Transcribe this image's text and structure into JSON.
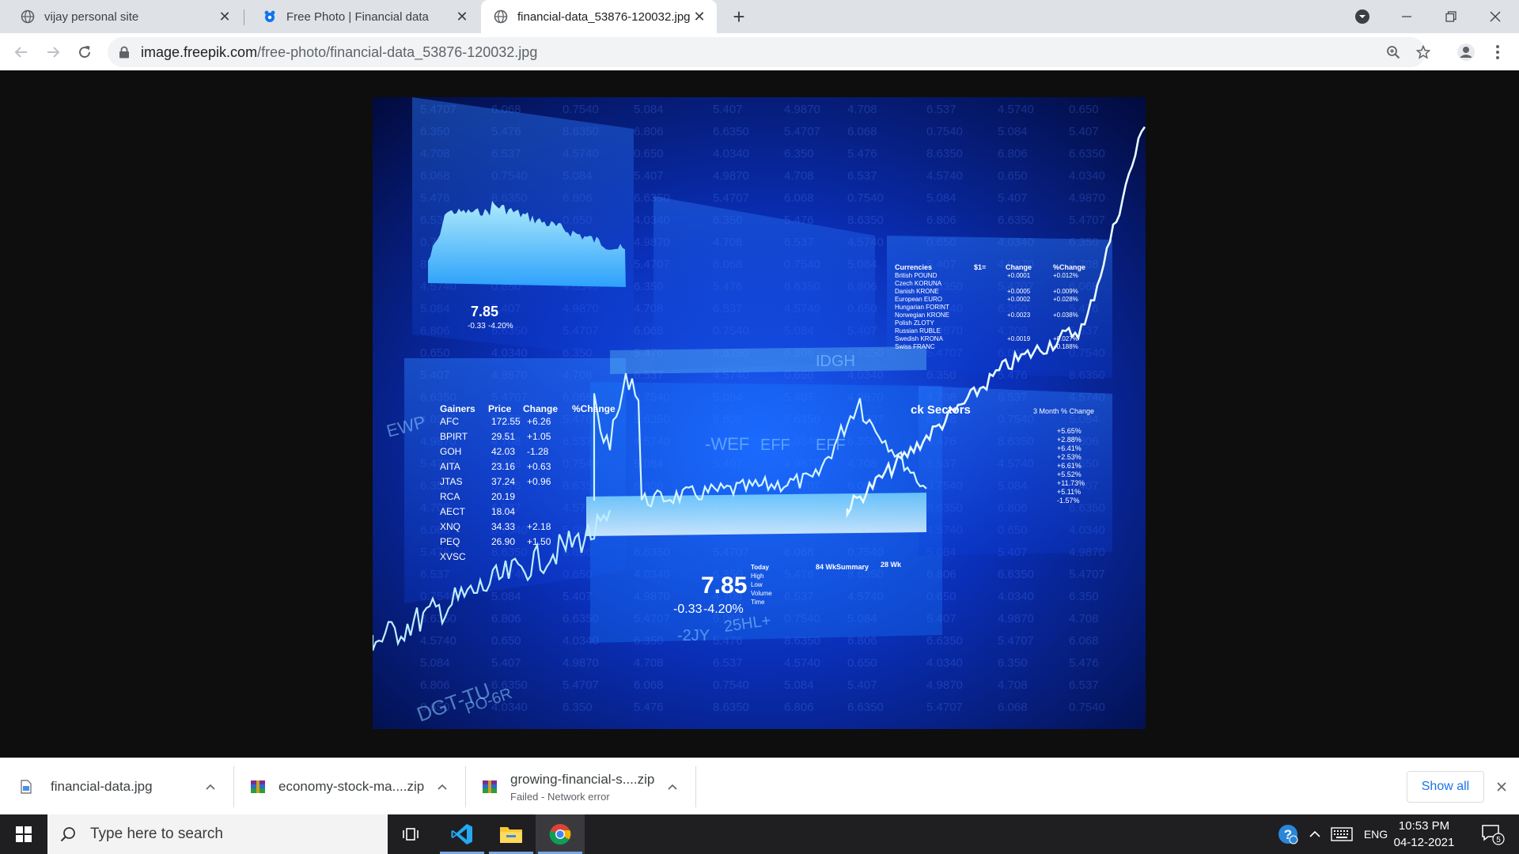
{
  "browser": {
    "tabs": [
      {
        "title": "vijay personal site",
        "favicon": "globe-icon",
        "active": false
      },
      {
        "title": "Free Photo | Financial data",
        "favicon": "freepik-icon",
        "active": false
      },
      {
        "title": "financial-data_53876-120032.jpg",
        "favicon": "globe-icon",
        "active": true
      }
    ],
    "address": {
      "host": "image.freepik.com",
      "path": "/free-photo/financial-data_53876-120032.jpg"
    },
    "accent": "#1a73e8"
  },
  "photo": {
    "gainers_table": {
      "headers": [
        "Gainers",
        "Price",
        "Change",
        "%Change"
      ],
      "rows": [
        [
          "AFC",
          "172.55",
          "+6.26"
        ],
        [
          "BPIRT",
          "29.51",
          "+1.05"
        ],
        [
          "GOH",
          "42.03",
          "-1.28"
        ],
        [
          "AITA",
          "23.16",
          "+0.63"
        ],
        [
          "JTAS",
          "37.24",
          "+0.96"
        ],
        [
          "RCA",
          "20.19",
          ""
        ],
        [
          "AECT",
          "18.04",
          ""
        ],
        [
          "XNQ",
          "34.33",
          "+2.18"
        ],
        [
          "PEQ",
          "26.90",
          "+1.50"
        ],
        [
          "XVSC",
          "",
          ""
        ]
      ]
    },
    "currency_panel": {
      "headers": [
        "Currencies",
        "$1=",
        "Change",
        "%Change"
      ],
      "rows": [
        "British POUND",
        "Czech KORUNA",
        "Danish KRONE",
        "European EURO",
        "Hungarian FORINT",
        "Norwegian KRONE",
        "Polish ZLOTY",
        "Russian RUBLE",
        "Swedish KRONA",
        "Swiss FRANC"
      ],
      "changes": [
        "+0.0001",
        "",
        "+0.0005",
        "+0.0002",
        "",
        "+0.0023",
        "",
        "",
        "+0.0019",
        ""
      ],
      "pct_changes": [
        "+0.012%",
        "",
        "+0.009%",
        "+0.028%",
        "",
        "+0.038%",
        "",
        "",
        "+0.027%",
        "+0.188%"
      ]
    },
    "sectors_panel": {
      "title": "ck Sectors",
      "subtitle": "3 Month % Change",
      "values": [
        "+5.65%",
        "+2.88%",
        "+6.41%",
        "+2.53%",
        "+6.61%",
        "+5.52%",
        "+11.73%",
        "+5.11%",
        "-1.57%"
      ]
    },
    "quote_small": {
      "price": "7.85",
      "change": "-0.33",
      "pct": "-4.20%"
    },
    "quote_big": {
      "price": "7.85",
      "change": "-0.33",
      "pct": "-4.20%",
      "labels": [
        "Today",
        "High",
        "Low",
        "Volume",
        "Time"
      ],
      "summary_title": "84 WkSummary",
      "summary_title2": "28 Wk"
    },
    "overlay_words": [
      "-WEF",
      "EFF",
      "EFF",
      "-2JY",
      "25HL+",
      "DGT-TU",
      "IDGH",
      "EWP",
      "PO-6R"
    ],
    "column_numbers": [
      "5.4707",
      "6.350",
      "4.708",
      "6.068",
      "5.476",
      "6.537",
      "0.7540",
      "8.6350",
      "4.5740",
      "5.084",
      "6.806",
      "0.650",
      "5.407",
      "6.6350",
      "4.0340",
      "4.9870"
    ],
    "colors": {
      "deep": "#020a3a",
      "mid": "#0a3fd1",
      "bright": "#3ec7ff",
      "glow": "#c8f2ff",
      "red": "#ff3b3b"
    }
  },
  "downloads": {
    "items": [
      {
        "name": "financial-data.jpg",
        "status": "",
        "icon": "image-file-icon"
      },
      {
        "name": "economy-stock-ma....zip",
        "status": "",
        "icon": "winrar-archive-icon"
      },
      {
        "name": "growing-financial-s....zip",
        "status": "Failed - Network error",
        "icon": "winrar-archive-icon"
      }
    ],
    "show_all": "Show all"
  },
  "taskbar": {
    "search_placeholder": "Type here to search",
    "language": "ENG",
    "time": "10:53 PM",
    "date": "04-12-2021",
    "notification_count": "5"
  }
}
